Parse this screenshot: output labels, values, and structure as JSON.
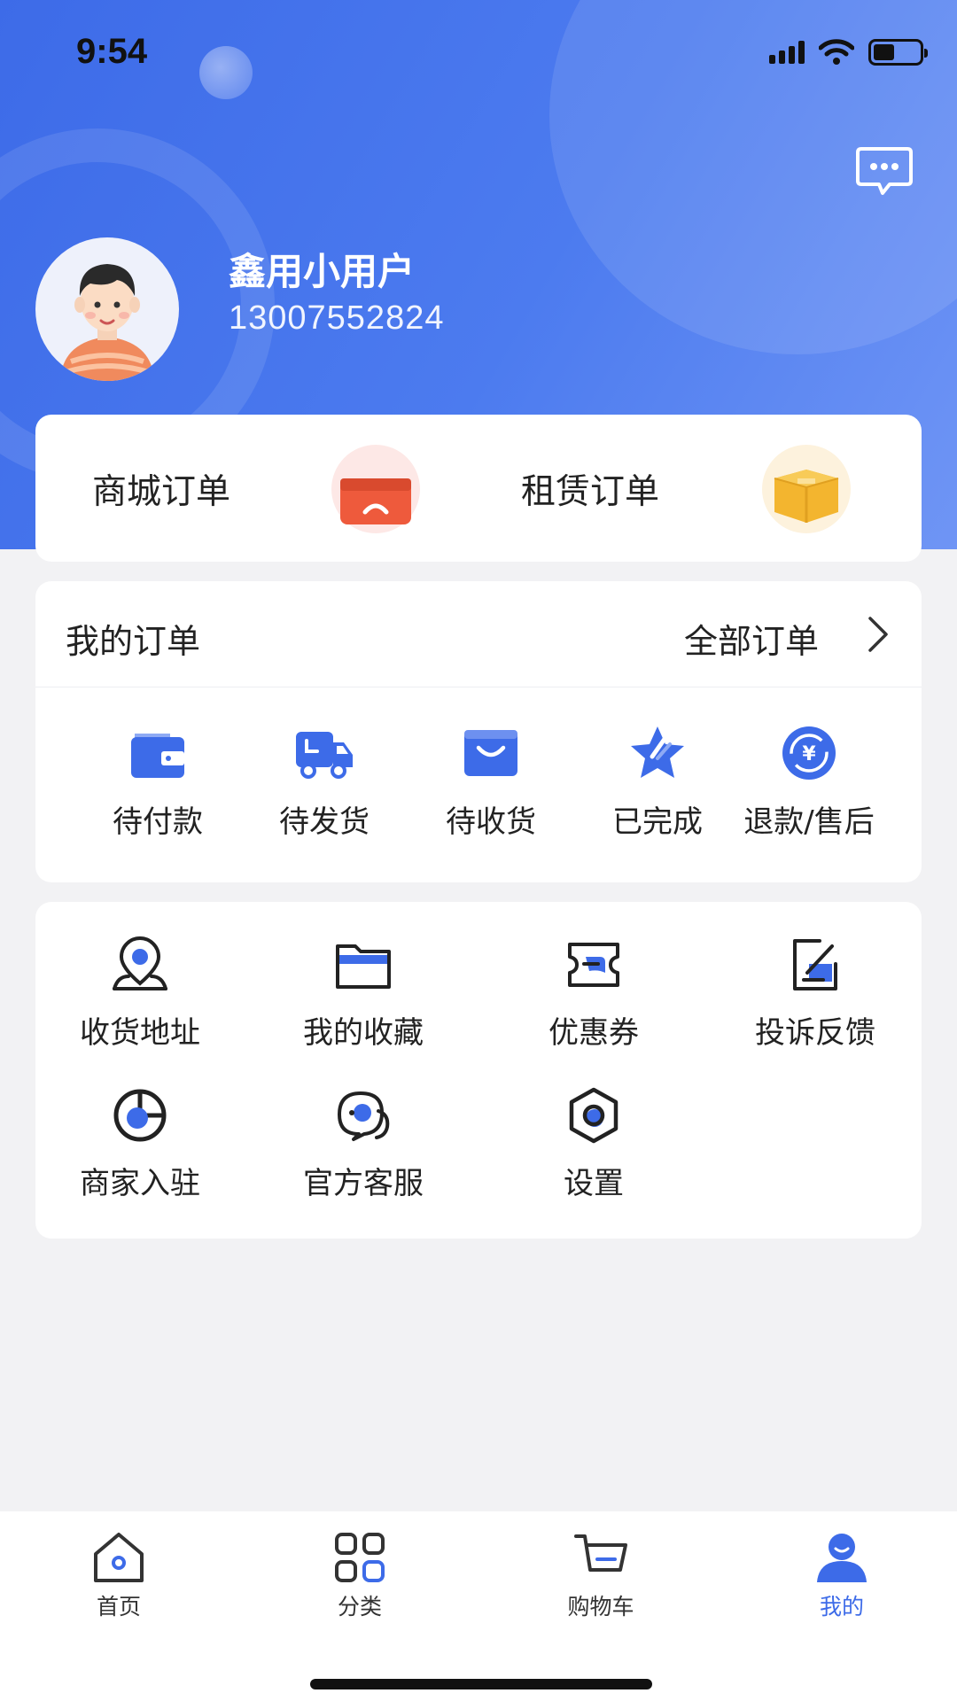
{
  "status_bar": {
    "time": "9:54"
  },
  "profile": {
    "name": "鑫用小用户",
    "phone": "13007552824"
  },
  "order_types": [
    {
      "label": "商城订单",
      "icon": "mall-order-icon"
    },
    {
      "label": "租赁订单",
      "icon": "lease-order-icon"
    }
  ],
  "my_orders": {
    "title": "我的订单",
    "all_label": "全部订单",
    "statuses": [
      {
        "label": "待付款",
        "icon": "wallet-icon"
      },
      {
        "label": "待发货",
        "icon": "truck-icon"
      },
      {
        "label": "待收货",
        "icon": "shopping-bag-icon"
      },
      {
        "label": "已完成",
        "icon": "star-check-icon"
      },
      {
        "label": "退款/售后",
        "icon": "refund-icon"
      }
    ]
  },
  "services": [
    {
      "label": "收货地址",
      "icon": "location-icon"
    },
    {
      "label": "我的收藏",
      "icon": "folder-icon"
    },
    {
      "label": "优惠券",
      "icon": "coupon-icon"
    },
    {
      "label": "投诉反馈",
      "icon": "feedback-icon"
    },
    {
      "label": "商家入驻",
      "icon": "merchant-icon"
    },
    {
      "label": "官方客服",
      "icon": "customer-service-icon"
    },
    {
      "label": "设置",
      "icon": "settings-icon"
    }
  ],
  "tabs": [
    {
      "label": "首页",
      "icon": "home-icon"
    },
    {
      "label": "分类",
      "icon": "category-icon"
    },
    {
      "label": "购物车",
      "icon": "cart-icon"
    },
    {
      "label": "我的",
      "icon": "profile-icon",
      "active": true
    }
  ],
  "colors": {
    "accent": "#3d6be8",
    "hero_end": "#6f95f5",
    "page_bg": "#f2f2f4"
  }
}
